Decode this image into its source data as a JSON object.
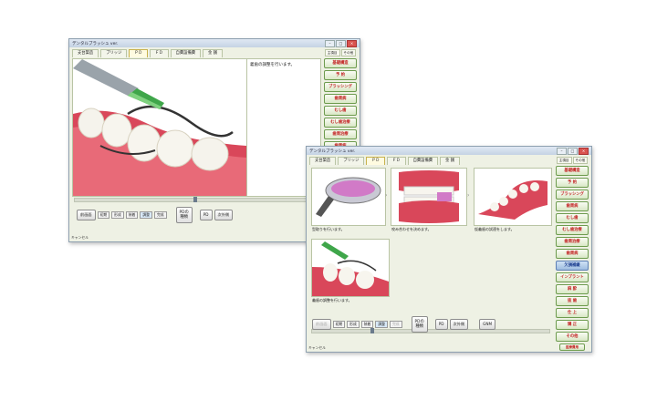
{
  "app_title": "デンタルブラッシュ ver.",
  "win1": {
    "tabs": [
      "支台築造",
      "ブリッジ",
      "ＰＤ",
      "ＦＤ",
      "自費設備費",
      "金 銭"
    ],
    "active_tab": 2,
    "note": "義歯の調整を行います。",
    "side_top": [
      "主項目",
      "その他"
    ],
    "side_buttons": [
      "基礎構造",
      "予 約",
      "ブラッシング",
      "歯周病",
      "むし歯",
      "むし歯治療",
      "歯周治療",
      "歯周病"
    ],
    "ctrl_left": "前画面",
    "ctrl_chips": [
      "初期",
      "形成",
      "装着",
      "調整",
      "完成"
    ],
    "ctrl_play": "PD",
    "ctrl_exam": "PDの\n種類",
    "ctrl_pd": "PD",
    "ctrl_next": "次外側",
    "status_left": "キャンセル"
  },
  "win2": {
    "tabs": [
      "支台築造",
      "ブリッジ",
      "ＰＤ",
      "ＦＤ",
      "自費設備費",
      "金 銭"
    ],
    "active_tab": 2,
    "captions": [
      "型取りを行います。",
      "咬み合わせを決めます。",
      "仮義歯の試適をします。",
      "義歯の調整を行います。"
    ],
    "side_top": [
      "主項目",
      "その他"
    ],
    "side_buttons": [
      "基礎構造",
      "予 約",
      "ブラッシング",
      "歯周病",
      "むし歯",
      "むし歯治療",
      "歯周治療",
      "歯周病",
      "欠損補綴",
      "インプラント",
      "麻 酔",
      "抜 歯",
      "仕 上",
      "矯 正",
      "その他",
      "医療費用"
    ],
    "active_side": 8,
    "ctrl_left": "前画面",
    "ctrl_chips": [
      "初期",
      "形成",
      "装着",
      "調整",
      "完成"
    ],
    "ctrl_exam": "PDの\n種類",
    "ctrl_pd": "PD",
    "ctrl_next": "次外側",
    "ctrl_right": "GNM",
    "status_left": "キャンセル"
  },
  "colors": {
    "accent": "#c21f1f",
    "panel": "#eef1e4",
    "titlebar": "#c4d3e4",
    "gum": "#d9475a"
  }
}
